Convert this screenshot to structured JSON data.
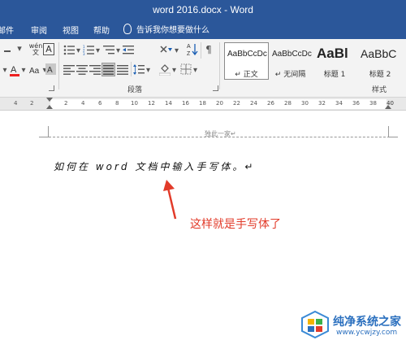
{
  "window": {
    "title": "word 2016.docx  -  Word"
  },
  "tabs": [
    {
      "label": "邮件"
    },
    {
      "label": "审阅"
    },
    {
      "label": "视图"
    },
    {
      "label": "帮助"
    }
  ],
  "tell_me": {
    "text": "告诉我你想要做什么"
  },
  "ribbon": {
    "font_group": {
      "phonetic_label": "wén\n文",
      "border_char_label": "A"
    },
    "paragraph_group": {
      "label": "段落"
    },
    "styles_group": {
      "label": "样式",
      "items": [
        {
          "sample": "AaBbCcDc",
          "name": "↵ 正文",
          "selected": true
        },
        {
          "sample": "AaBbCcDc",
          "name": "↵ 无间隔",
          "selected": false
        },
        {
          "sample": "AaBl",
          "name": "标题 1",
          "selected": false
        },
        {
          "sample": "AaBbC",
          "name": "标题 2",
          "selected": false
        }
      ]
    }
  },
  "ruler": {
    "ticks": [
      "4",
      "2",
      "2",
      "4",
      "6",
      "8",
      "10",
      "12",
      "14",
      "16",
      "18",
      "20",
      "22",
      "24",
      "26",
      "28",
      "30",
      "32",
      "34",
      "36",
      "38",
      "40"
    ]
  },
  "document": {
    "header_text": "独此一家↵",
    "body_text": "如何在 word 文档中输入手写体。↵",
    "annotation": "这样就是手写体了"
  },
  "watermark": {
    "title": "纯净系统之家",
    "url": "www.ycwjzy.com"
  },
  "colors": {
    "title_bar": "#2b579a",
    "annotation": "#e23b2a",
    "watermark": "#2a6fbe"
  }
}
